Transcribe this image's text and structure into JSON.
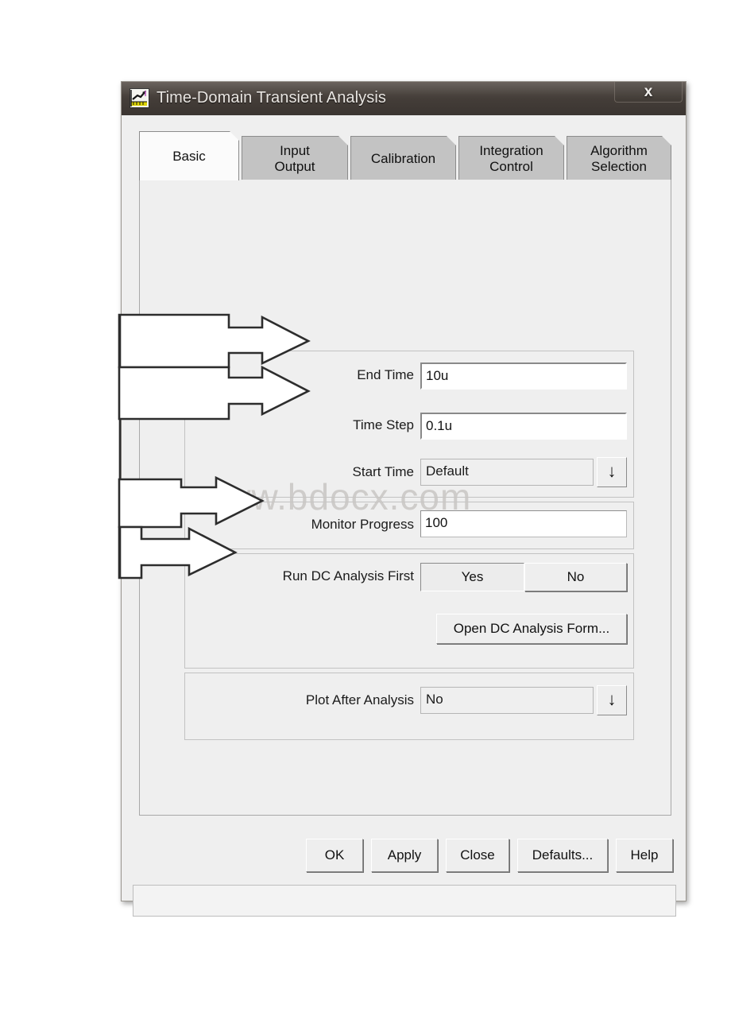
{
  "window": {
    "title": "Time-Domain Transient Analysis",
    "icon": "plot-icon",
    "close_label": "x"
  },
  "tabs": [
    {
      "label": "Basic",
      "active": true
    },
    {
      "label": "Input\nOutput",
      "active": false
    },
    {
      "label": "Calibration",
      "active": false
    },
    {
      "label": "Integration\nControl",
      "active": false
    },
    {
      "label": "Algorithm\nSelection",
      "active": false
    }
  ],
  "fields": {
    "end_time": {
      "label": "End Time",
      "value": "10u",
      "type": "text"
    },
    "time_step": {
      "label": "Time Step",
      "value": "0.1u",
      "type": "text"
    },
    "start_time": {
      "label": "Start Time",
      "value": "Default",
      "type": "combo",
      "arrow": "↓"
    },
    "monitor_progress": {
      "label": "Monitor Progress",
      "value": "100",
      "type": "text"
    },
    "run_dc_first": {
      "label": "Run DC Analysis First",
      "yes_label": "Yes",
      "no_label": "No",
      "selected": "Yes"
    },
    "open_dc_form": {
      "label": "Open DC Analysis Form..."
    },
    "plot_after": {
      "label": "Plot After Analysis",
      "value": "No",
      "type": "combo",
      "arrow": "↓"
    }
  },
  "buttons": {
    "ok": "OK",
    "apply": "Apply",
    "close": "Close",
    "defaults": "Defaults...",
    "help": "Help"
  },
  "statusbar": {
    "text": ""
  },
  "watermark": {
    "text": "www.bdocx.com"
  },
  "annotations": {
    "callouts": [
      {
        "target": "End Time"
      },
      {
        "target": "Time Step"
      },
      {
        "target": "Monitor Progress"
      },
      {
        "target": "Run DC Analysis First"
      }
    ]
  },
  "colors": {
    "dialog_face": "#efefef",
    "titlebar": "#463f3a",
    "tab_inactive": "#c3c3c3",
    "tab_active": "#fbfbfb",
    "field_bg": "#ffffff",
    "watermark": "#c9c6c4"
  }
}
